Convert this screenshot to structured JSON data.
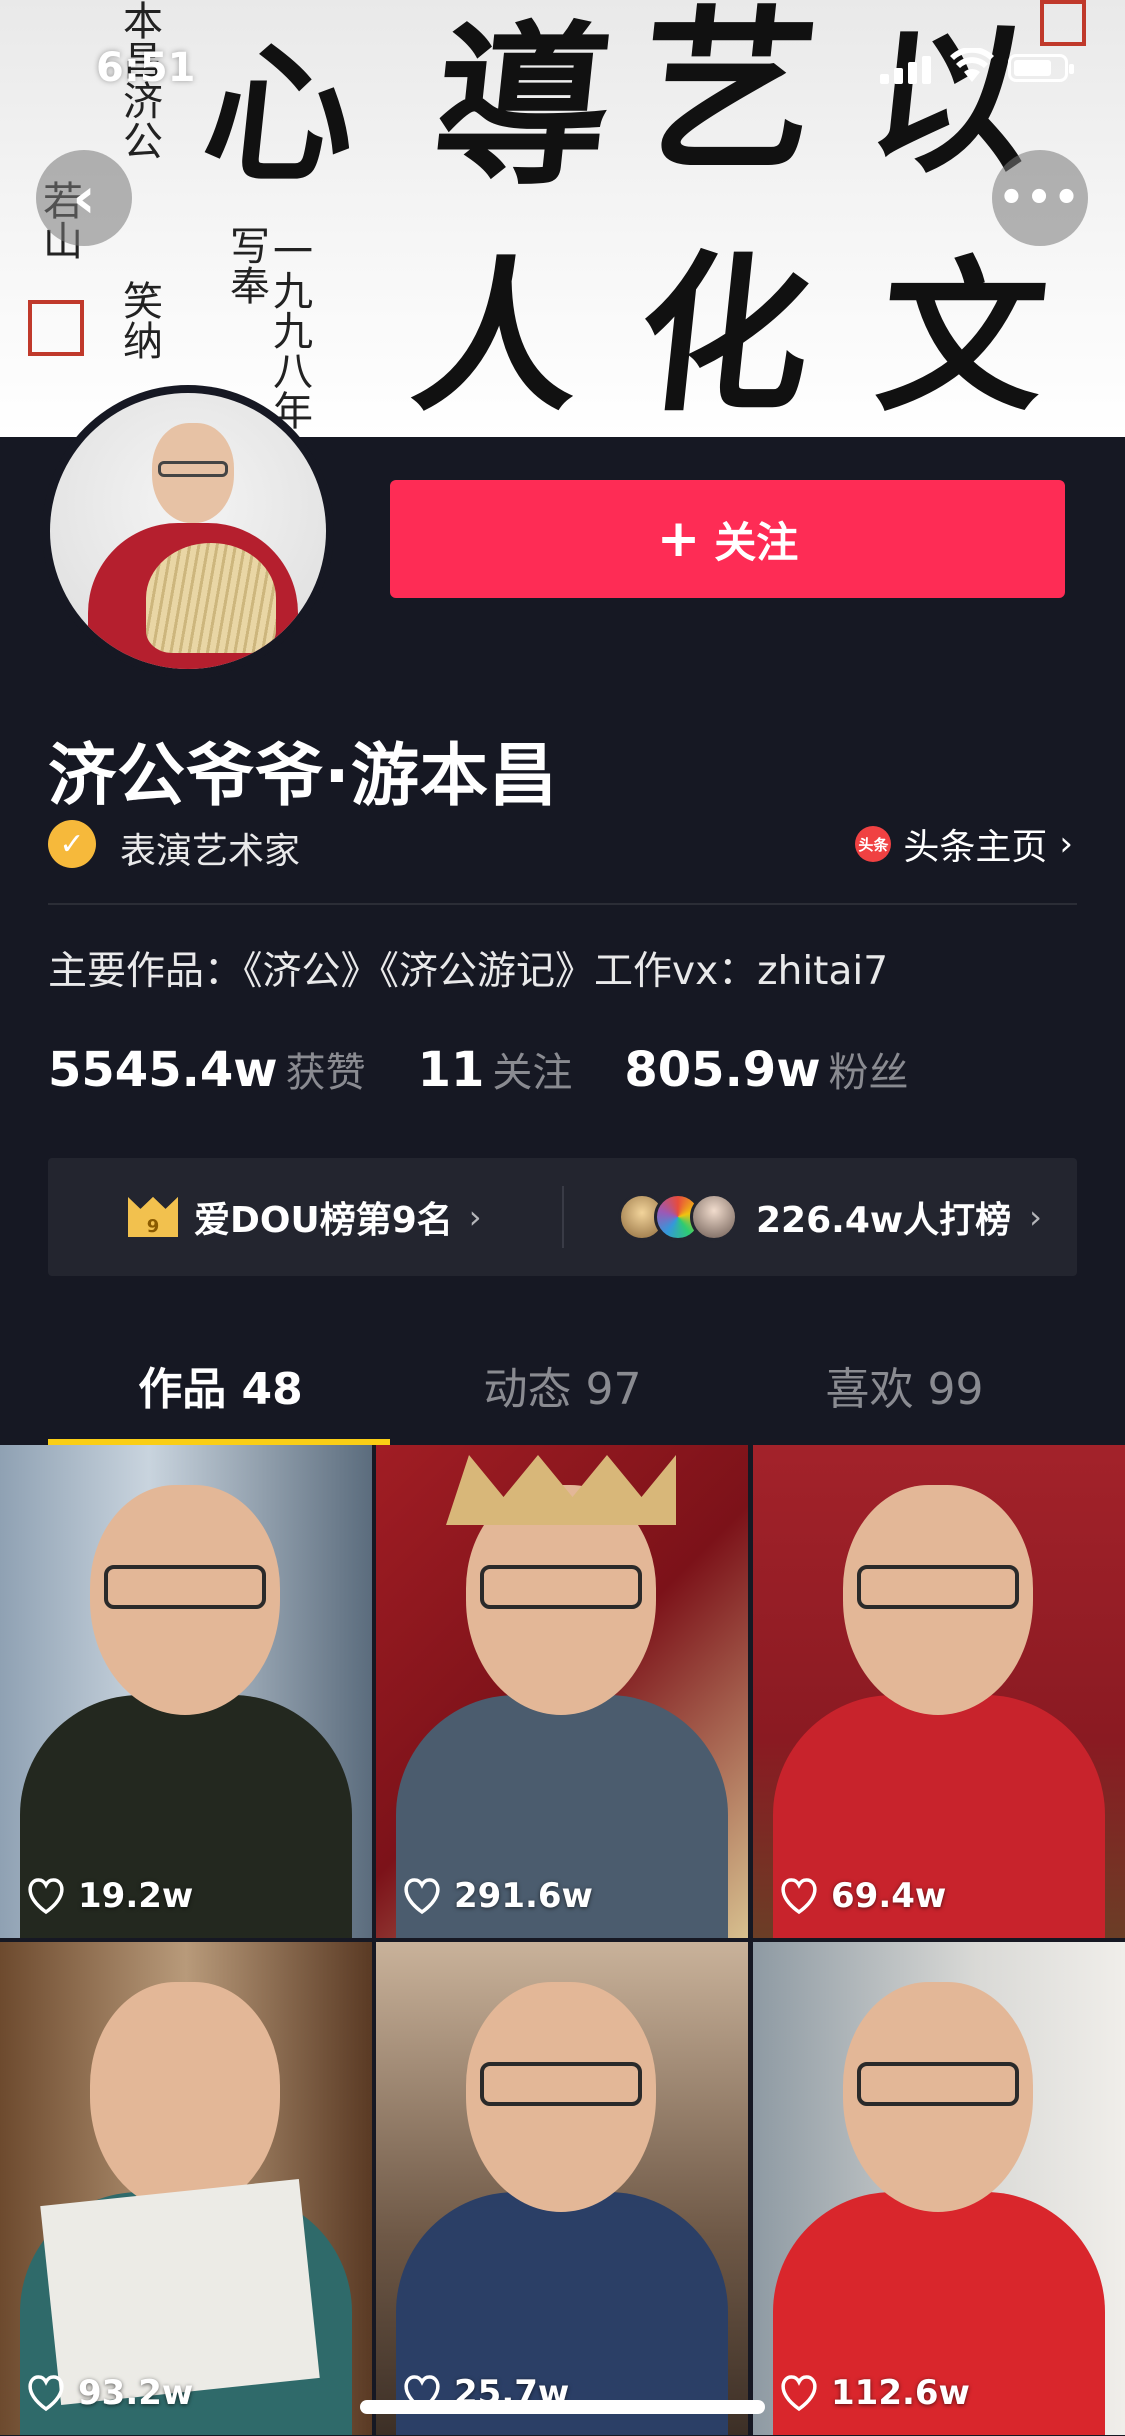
{
  "status_bar": {
    "time": "6:51"
  },
  "banner": {
    "calligraphy_top": [
      "心",
      "導",
      "艺",
      "以"
    ],
    "calligraphy_bottom": [
      "人",
      "化",
      "文"
    ],
    "inscription_1": "本昌济公",
    "inscription_2": "写奉",
    "inscription_3": "一九九八年",
    "inscription_4": "若山",
    "inscription_5": "笑纳"
  },
  "nav": {
    "back_icon": "chevron-left-icon",
    "more_icon": "ellipsis-icon"
  },
  "profile": {
    "name": "济公爷爷·游本昌",
    "verification": "表演艺术家",
    "toutiao_icon_text": "头条",
    "toutiao_link": "头条主页",
    "works_line": "主要作品：《济公》《济公游记》工作vx：zhitai7",
    "stats": [
      {
        "value": "5545.4w",
        "label": "获赞"
      },
      {
        "value": "11",
        "label": "关注"
      },
      {
        "value": "805.9w",
        "label": "粉丝"
      }
    ],
    "follow_label": "关注"
  },
  "rank": {
    "crown_number": "9",
    "dou_rank": "爱DOU榜第9名",
    "supporters": "226.4w人打榜"
  },
  "tabs": [
    {
      "label": "作品 48"
    },
    {
      "label": "动态 97"
    },
    {
      "label": "喜欢 99"
    }
  ],
  "videos": [
    {
      "likes": "19.2w"
    },
    {
      "likes": "291.6w"
    },
    {
      "likes": "69.4w"
    },
    {
      "likes": "93.2w"
    },
    {
      "likes": "25.7w"
    },
    {
      "likes": "112.6w"
    }
  ],
  "colors": {
    "background": "#161823",
    "follow_button": "#fe2c55",
    "tab_underline": "#face15",
    "verified_badge": "#f6b93b"
  }
}
